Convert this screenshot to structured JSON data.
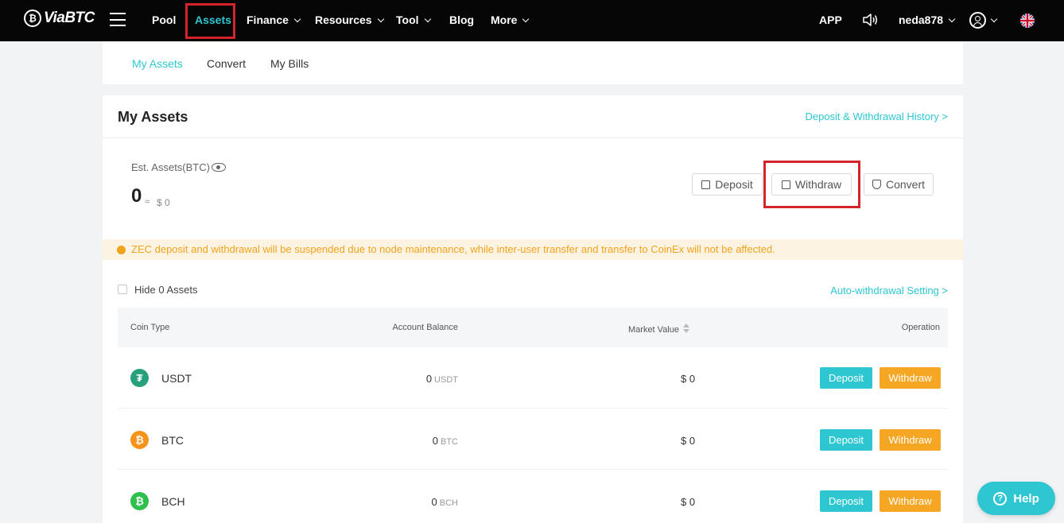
{
  "brand": {
    "name": "ViaBTC",
    "mark": "₿"
  },
  "nav": {
    "items": [
      {
        "label": "Pool"
      },
      {
        "label": "Assets"
      },
      {
        "label": "Finance"
      },
      {
        "label": "Resources"
      },
      {
        "label": "Tool"
      },
      {
        "label": "Blog"
      },
      {
        "label": "More"
      }
    ],
    "active": "Assets",
    "app_label": "APP",
    "username": "neda878",
    "language_icon": "uk-flag-icon"
  },
  "subtabs": [
    "My Assets",
    "Convert",
    "My Bills"
  ],
  "assets": {
    "title": "My Assets",
    "history_link": "Deposit & Withdrawal History >",
    "est_label": "Est. Assets(BTC)",
    "est_value": "0",
    "approx": "≈",
    "usd_value": "$ 0",
    "actions": {
      "deposit": "Deposit",
      "withdraw": "Withdraw",
      "convert": "Convert"
    },
    "notice": "ZEC deposit and withdrawal will be suspended due to node maintenance, while inter-user transfer and transfer to CoinEx will not be affected.",
    "hide_zero_label": "Hide 0 Assets",
    "auto_withdraw_link": "Auto-withdrawal Setting >"
  },
  "table": {
    "headers": [
      "Coin Type",
      "Account Balance",
      "Market Value",
      "Operation"
    ],
    "rows": [
      {
        "coin": "USDT",
        "balance": "0",
        "unit": "USDT",
        "value": "$ 0",
        "icon_color": "#26a17b",
        "icon": "tether-icon",
        "glyph": "₮"
      },
      {
        "coin": "BTC",
        "balance": "0",
        "unit": "BTC",
        "value": "$ 0",
        "icon_color": "#f7931a",
        "icon": "bitcoin-icon",
        "glyph": "₿"
      },
      {
        "coin": "BCH",
        "balance": "0",
        "unit": "BCH",
        "value": "$ 0",
        "icon_color": "#2fbf4c",
        "icon": "bitcoin-cash-icon",
        "glyph": "₿"
      }
    ],
    "deposit_label": "Deposit",
    "withdraw_label": "Withdraw"
  },
  "help_label": "Help",
  "colors": {
    "accent": "#2ec7d1",
    "warning": "#f5a623",
    "highlight": "#d3242c"
  }
}
